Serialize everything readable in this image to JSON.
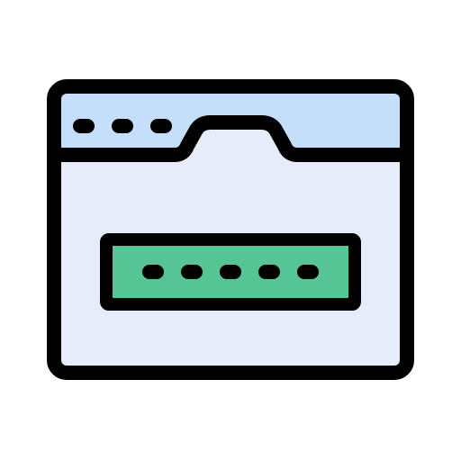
{
  "icon": {
    "name": "browser-password-icon",
    "colors": {
      "outline": "#000000",
      "titlebar": "#C5DFFB",
      "window_body": "#E6ECF9",
      "password_field": "#56C596",
      "background": "#FFFFFF"
    },
    "window_control_dots": 3,
    "masked_characters": 5
  }
}
